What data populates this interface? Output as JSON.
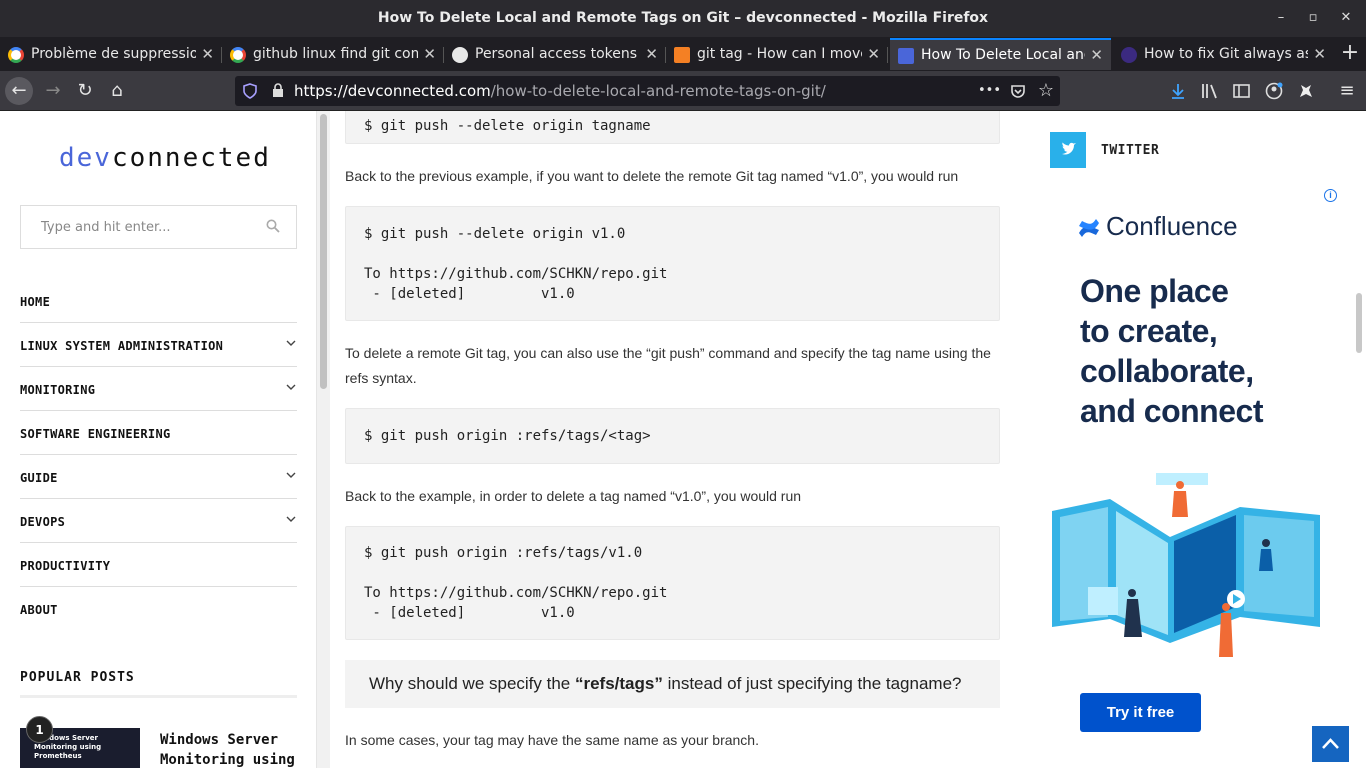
{
  "window": {
    "title": "How To Delete Local and Remote Tags on Git – devconnected - Mozilla Firefox",
    "minimize": "–",
    "maximize": "▫",
    "close": "✕"
  },
  "tabs": [
    {
      "label": "Problème de suppression",
      "icon": "google-icon",
      "close": "✕"
    },
    {
      "label": "github linux find git com",
      "icon": "google-icon",
      "close": "✕"
    },
    {
      "label": "Personal access tokens",
      "icon": "github-icon",
      "close": "✕"
    },
    {
      "label": "git tag - How can I move",
      "icon": "stackoverflow-icon",
      "close": "✕"
    },
    {
      "label": "How To Delete Local and",
      "icon": "devconnected-icon",
      "close": "✕"
    },
    {
      "label": "How to fix Git always ask",
      "icon": "dev-icon",
      "close": "✕"
    }
  ],
  "new_tab": "+",
  "nav": {
    "back": "←",
    "forward": "→",
    "reload": "↻",
    "home": "⌂",
    "url_host": "https://devconnected.com",
    "url_path": "/how-to-delete-local-and-remote-tags-on-git/",
    "more": "•••",
    "bookmark": "☆",
    "menu": "≡"
  },
  "sidebar": {
    "logo_a": "dev",
    "logo_b": "connected",
    "search_placeholder": "Type and hit enter...",
    "menu": [
      {
        "label": "HOME",
        "has_sub": false
      },
      {
        "label": "LINUX SYSTEM ADMINISTRATION",
        "has_sub": true
      },
      {
        "label": "MONITORING",
        "has_sub": true
      },
      {
        "label": "SOFTWARE ENGINEERING",
        "has_sub": false
      },
      {
        "label": "GUIDE",
        "has_sub": true
      },
      {
        "label": "DEVOPS",
        "has_sub": true
      },
      {
        "label": "PRODUCTIVITY",
        "has_sub": false
      },
      {
        "label": "ABOUT",
        "has_sub": false
      }
    ],
    "popular_title": "POPULAR POSTS",
    "post_rank": "1",
    "post_thumb_text": "Windows Server Monitoring using Prometheus",
    "post_title": "Windows Server Monitoring using"
  },
  "content": {
    "code0": "$ git push --delete origin tagname",
    "p1": "Back to the previous example, if you want to delete the remote Git tag named “v1.0”, you would run",
    "code1": "$ git push --delete origin v1.0\n\nTo https://github.com/SCHKN/repo.git\n - [deleted]         v1.0",
    "p2": "To delete a remote Git tag, you can also use the “git push” command and specify the tag name using the refs syntax.",
    "code2": "$ git push origin :refs/tags/<tag>",
    "p3": "Back to the example, in order to delete a tag named “v1.0”, you would run",
    "code3": "$ git push origin :refs/tags/v1.0\n\nTo https://github.com/SCHKN/repo.git\n - [deleted]         v1.0",
    "callout_pre": "Why should we specify the ",
    "callout_bold": "“refs/tags”",
    "callout_post": " instead of just specifying the tagname?",
    "p4": "In some cases, your tag may have the same name as your branch."
  },
  "right": {
    "twitter_label": "TWITTER",
    "ad_info": "i",
    "ad_brand": "Confluence",
    "ad_headline": [
      "One place",
      "to create,",
      "collaborate,",
      "and connect"
    ],
    "ad_cta": "Try it free"
  },
  "colors": {
    "accent": "#0a84ff",
    "logo_blue": "#4a66d9",
    "twitter": "#29b0ea",
    "confluence_blue": "#0052cc",
    "totop": "#1565c0"
  }
}
